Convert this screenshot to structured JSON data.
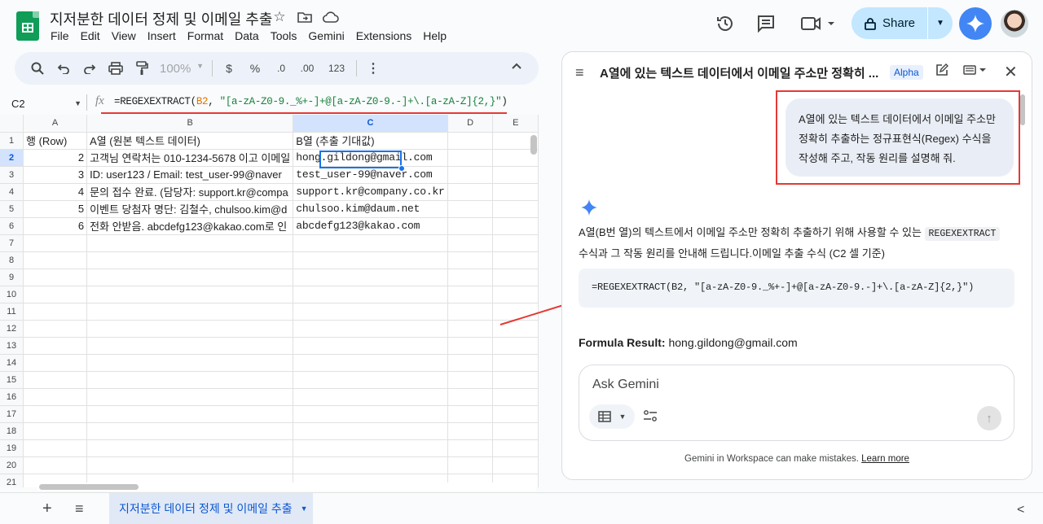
{
  "app": {
    "doc_title": "지저분한 데이터 정제 및 이메일 추출",
    "menu": [
      "File",
      "Edit",
      "View",
      "Insert",
      "Format",
      "Data",
      "Tools",
      "Gemini",
      "Extensions",
      "Help"
    ],
    "share_label": "Share"
  },
  "toolbar": {
    "zoom": "100%",
    "currency": "$",
    "percent": "%",
    "dec_less": ".0",
    "dec_more": ".00",
    "num_format": "123"
  },
  "formula_bar": {
    "cell_ref": "C2",
    "fx": "fx",
    "formula_prefix": "=REGEXEXTRACT(",
    "formula_ref": "B2",
    "formula_mid": ", ",
    "formula_str": "\"[a-zA-Z0-9._%+-]+@[a-zA-Z0-9.-]+\\.[a-zA-Z]{2,}\"",
    "formula_suffix": ")"
  },
  "sheet": {
    "columns": [
      "A",
      "B",
      "C",
      "D",
      "E"
    ],
    "selected_col": "C",
    "selected_row": "2",
    "rows": [
      {
        "num": "1",
        "a": "행 (Row)",
        "b": "A열 (원본 텍스트 데이터)",
        "c": "B열 (추출 기대값)"
      },
      {
        "num": "2",
        "a": "2",
        "b": "고객님 연락처는 010-1234-5678 이고 이메일",
        "c": "hong.gildong@gmail.com"
      },
      {
        "num": "3",
        "a": "3",
        "b": "ID: user123 / Email: test_user-99@naver",
        "c": "test_user-99@naver.com"
      },
      {
        "num": "4",
        "a": "4",
        "b": "문의 접수 완료. (담당자: support.kr@compa",
        "c": "support.kr@company.co.kr"
      },
      {
        "num": "5",
        "a": "5",
        "b": "이벤트 당첨자 명단: 김철수, chulsoo.kim@d",
        "c": "chulsoo.kim@daum.net"
      },
      {
        "num": "6",
        "a": "6",
        "b": "전화 안받음. abcdefg123@kakao.com로 인",
        "c": "abcdefg123@kakao.com"
      },
      {
        "num": "7"
      },
      {
        "num": "8"
      },
      {
        "num": "9"
      },
      {
        "num": "10"
      },
      {
        "num": "11"
      },
      {
        "num": "12"
      },
      {
        "num": "13"
      },
      {
        "num": "14"
      },
      {
        "num": "15"
      },
      {
        "num": "16"
      },
      {
        "num": "17"
      },
      {
        "num": "18"
      },
      {
        "num": "19"
      },
      {
        "num": "20"
      },
      {
        "num": "21"
      }
    ],
    "tab_name": "지저분한 데이터 정제 및 이메일 추출"
  },
  "gemini_panel": {
    "title": "A열에 있는 텍스트 데이터에서 이메일 주소만 정확히 ...",
    "badge": "Alpha",
    "user_message": "A열에 있는 텍스트 데이터에서 이메일 주소만 정확히 추출하는 정규표현식(Regex) 수식을 작성해 주고, 작동 원리를 설명해 줘.",
    "response_part1": "A열(B번 열)의 텍스트에서 이메일 주소만 정확히 추출하기 위해 사용할 수 있는",
    "response_code": "REGEXEXTRACT",
    "response_part2": "수식과 그 작동 원리를 안내해 드립니다.이메일 추출 수식 (C2 셀 기준)",
    "code_block": "=REGEXEXTRACT(B2, \"[a-zA-Z0-9._%+-]+@[a-zA-Z0-9.-]+\\.[a-zA-Z]{2,}\")",
    "result_label": "Formula Result:",
    "result_value": "hong.gildong@gmail.com",
    "ask_placeholder": "Ask Gemini",
    "disclaimer": "Gemini in Workspace can make mistakes.",
    "learn_more": "Learn more"
  },
  "colors": {
    "accent": "#1a73e8",
    "share_bg": "#c2e7ff",
    "annotation_red": "#e53935",
    "sheets_green": "#0f9d58"
  }
}
